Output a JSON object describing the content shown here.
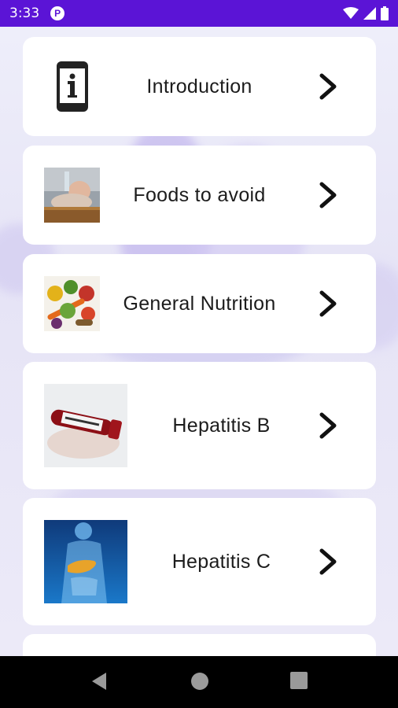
{
  "status": {
    "time": "3:33"
  },
  "menu": [
    {
      "label": "Introduction",
      "icon": "info-phone-icon"
    },
    {
      "label": "Foods to avoid",
      "icon": "sleeping-person-image"
    },
    {
      "label": "General Nutrition",
      "icon": "vegetables-image"
    },
    {
      "label": "Hepatitis B",
      "icon": "blood-sample-image"
    },
    {
      "label": "Hepatitis C",
      "icon": "liver-anatomy-image"
    }
  ],
  "colors": {
    "status_bar": "#5b14d6",
    "card": "#ffffff",
    "nav_bar": "#000000"
  }
}
